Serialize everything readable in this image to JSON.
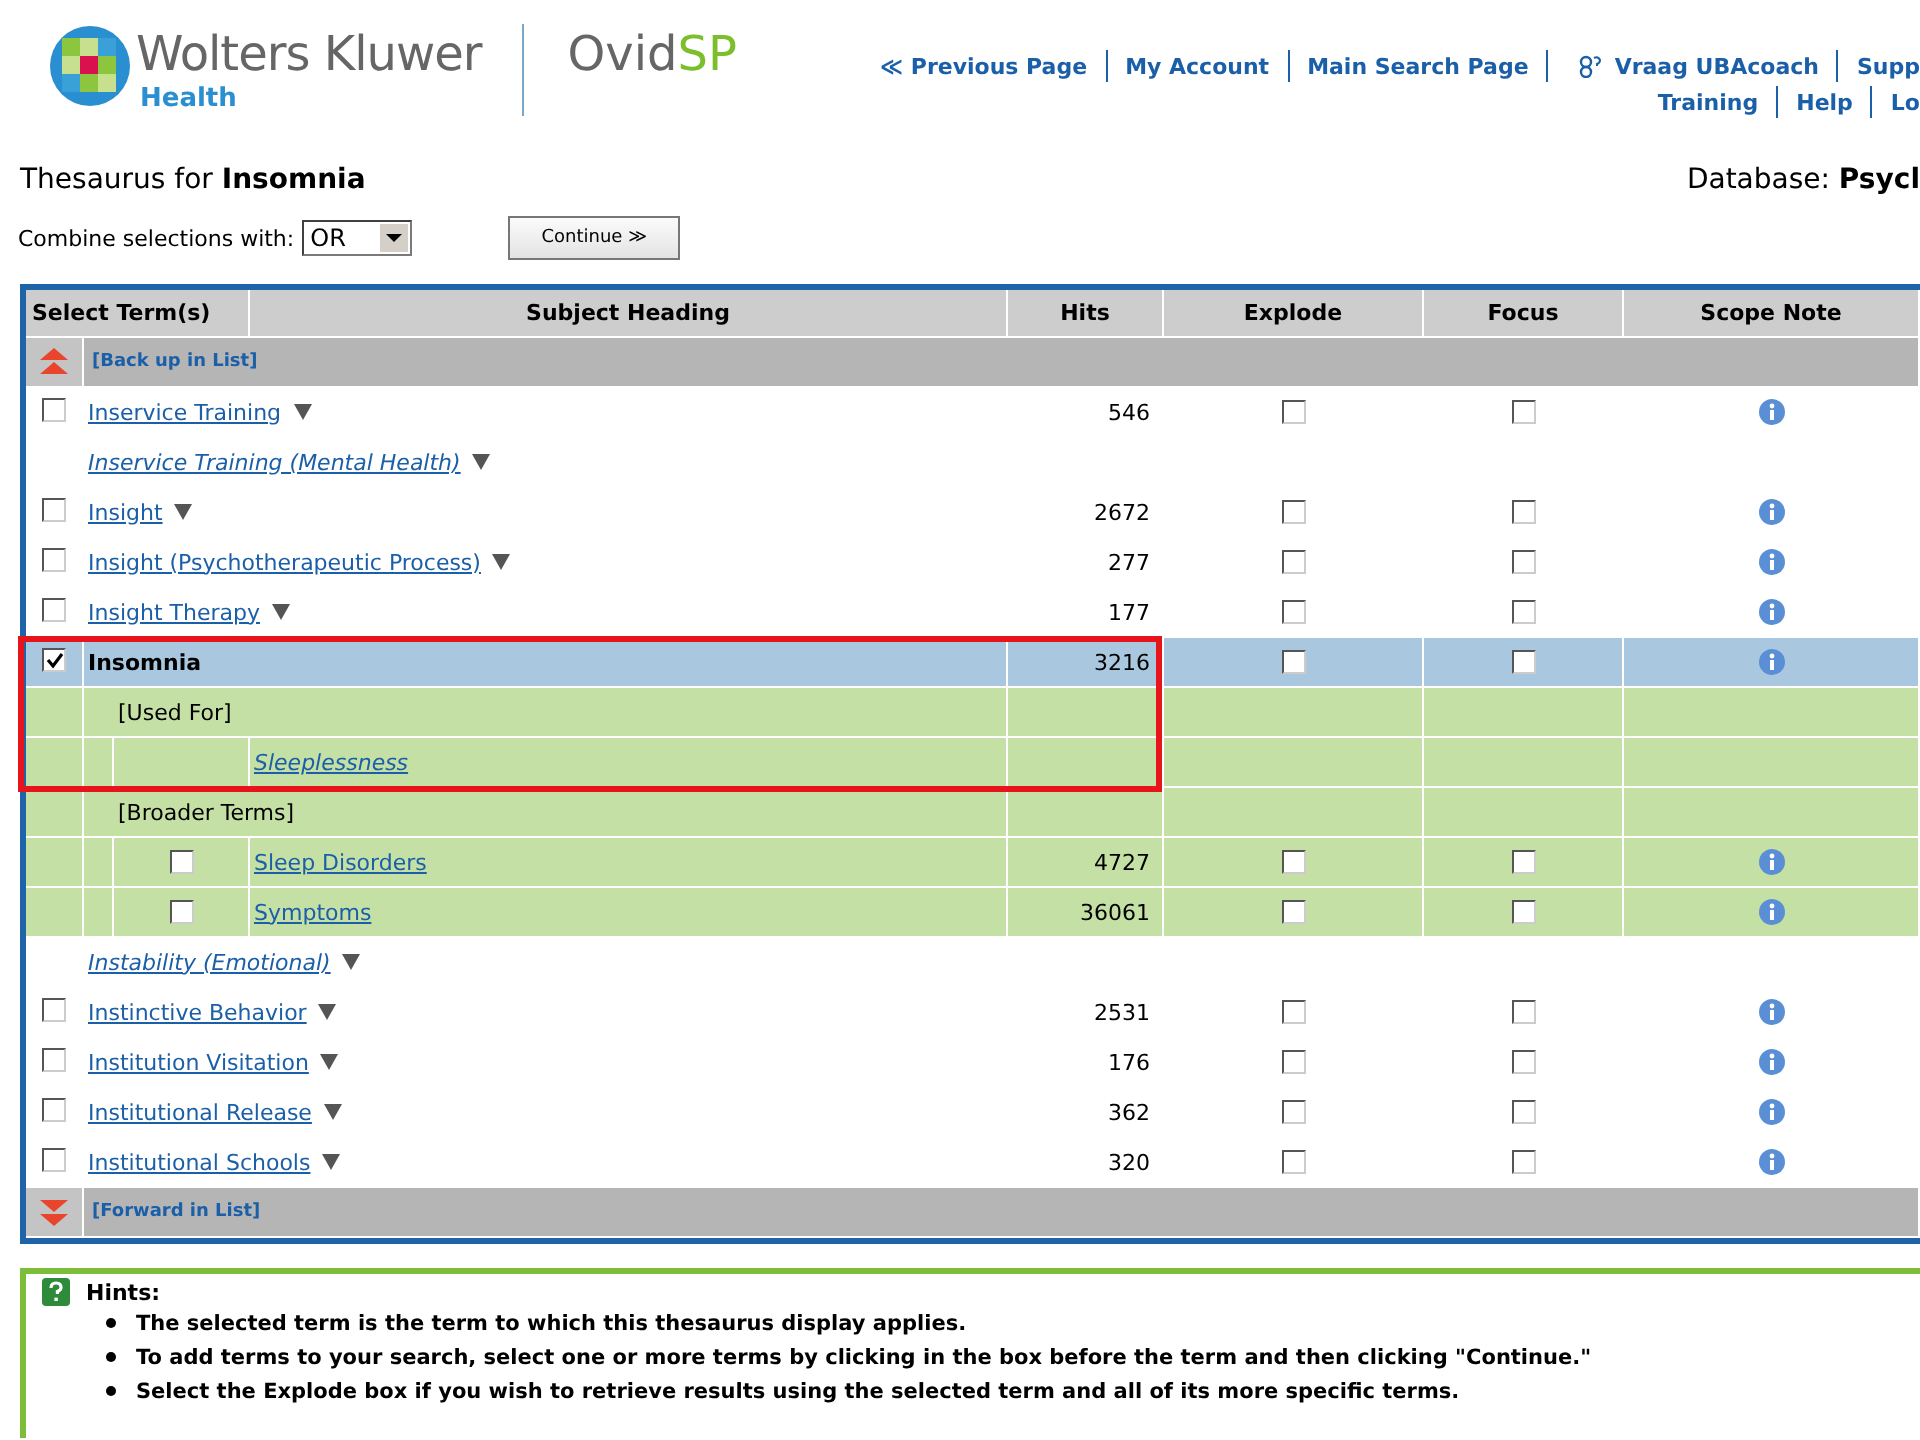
{
  "header": {
    "brand": "Wolters Kluwer",
    "brand_sub": "Health",
    "product": "Ovid",
    "product_suffix": "SP",
    "nav_top": [
      {
        "kind": "back",
        "label": "≪ Previous Page"
      },
      {
        "kind": "link",
        "label": "My Account"
      },
      {
        "kind": "link",
        "label": "Main Search Page"
      },
      {
        "kind": "ask",
        "label": "Vraag UBAcoach"
      },
      {
        "kind": "link",
        "label": "Supp"
      }
    ],
    "nav_bottom": [
      {
        "kind": "link",
        "label": "Training"
      },
      {
        "kind": "link",
        "label": "Help"
      },
      {
        "kind": "link",
        "label": "Lo"
      }
    ]
  },
  "title": "Thesaurus for **Insomnia**",
  "database": "Database: **Psycl**",
  "combine": {
    "label": "Combine selections with:",
    "value": "OR"
  },
  "continue_button": "Continue ≫",
  "table": {
    "columns": [
      "Select Term(s)",
      "Subject Heading",
      "Hits",
      "Explode",
      "Focus",
      "Scope Note"
    ],
    "rows": [
      {
        "kind": "back",
        "label": "[Back up in List]"
      },
      {
        "kind": "term",
        "label": "Inservice Training",
        "menu": true,
        "checked": false,
        "selected": false,
        "hits": "546",
        "explode": false,
        "focus": false
      },
      {
        "kind": "see",
        "label": "Inservice Training (Mental Health)",
        "menu": true
      },
      {
        "kind": "term",
        "label": "Insight",
        "menu": true,
        "checked": false,
        "selected": false,
        "hits": "2672",
        "explode": false,
        "focus": false
      },
      {
        "kind": "term",
        "label": "Insight (Psychotherapeutic Process)",
        "menu": true,
        "checked": false,
        "selected": false,
        "hits": "277",
        "explode": false,
        "focus": false
      },
      {
        "kind": "term",
        "label": "Insight Therapy",
        "menu": true,
        "checked": false,
        "selected": false,
        "hits": "177",
        "explode": false,
        "focus": false
      },
      {
        "kind": "term",
        "label": "Insomnia",
        "menu": false,
        "checked": true,
        "selected": true,
        "hits": "3216",
        "explode": false,
        "focus": false,
        "highlighted": true
      },
      {
        "kind": "section",
        "label": "[Used For]",
        "highlighted": true
      },
      {
        "kind": "used_for",
        "label": "Sleeplessness",
        "highlighted": true
      },
      {
        "kind": "section",
        "label": "[Broader Terms]"
      },
      {
        "kind": "broader",
        "label": "Sleep Disorders",
        "checked": false,
        "hits": "4727",
        "explode": false,
        "focus": false
      },
      {
        "kind": "broader",
        "label": "Symptoms",
        "checked": false,
        "hits": "36061",
        "explode": false,
        "focus": false
      },
      {
        "kind": "see",
        "label": "Instability (Emotional)",
        "menu": true
      },
      {
        "kind": "term",
        "label": "Instinctive Behavior",
        "menu": true,
        "checked": false,
        "selected": false,
        "hits": "2531",
        "explode": false,
        "focus": false
      },
      {
        "kind": "term",
        "label": "Institution Visitation",
        "menu": true,
        "checked": false,
        "selected": false,
        "hits": "176",
        "explode": false,
        "focus": false
      },
      {
        "kind": "term",
        "label": "Institutional Release",
        "menu": true,
        "checked": false,
        "selected": false,
        "hits": "362",
        "explode": false,
        "focus": false
      },
      {
        "kind": "term",
        "label": "Institutional Schools",
        "menu": true,
        "checked": false,
        "selected": false,
        "hits": "320",
        "explode": false,
        "focus": false
      },
      {
        "kind": "forward",
        "label": "[Forward in List]"
      }
    ]
  },
  "hints": {
    "title": "Hints:",
    "items": [
      "The selected term is the term to which this thesaurus display applies.",
      "To add terms to your search, select one or more terms by clicking in the box before the term and then clicking \"Continue.\"",
      "Select the Explode box if you wish to retrieve results using the selected term and all of its more specific terms."
    ]
  }
}
